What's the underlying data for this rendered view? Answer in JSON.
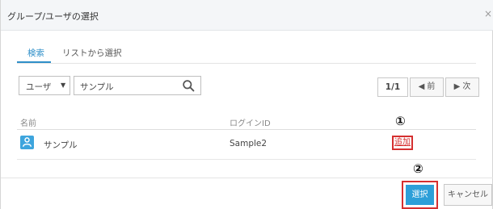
{
  "dialog": {
    "title": "グループ/ユーザの選択",
    "close_glyph": "×"
  },
  "tabs": [
    {
      "label": "検索"
    },
    {
      "label": "リストから選択"
    }
  ],
  "filter": {
    "type_selected": "ユーザ",
    "caret_icon": "triangle-down-icon",
    "search_value": "サンプル",
    "search_icon": "search-icon"
  },
  "pager": {
    "count": "1/1",
    "prev_label": "◀ 前",
    "next_label": "▶ 次"
  },
  "table": {
    "columns": [
      "名前",
      "ログインID"
    ],
    "rows": [
      {
        "icon": "user-icon",
        "name": "サンプル",
        "login_id": "Sample2",
        "action": "追加"
      }
    ]
  },
  "annotations": [
    "①",
    "②"
  ],
  "footer": {
    "select_label": "選択",
    "cancel_label": "キャンセル"
  },
  "colors": {
    "accent": "#2d9fd8",
    "highlight_border": "#d52f2f"
  }
}
